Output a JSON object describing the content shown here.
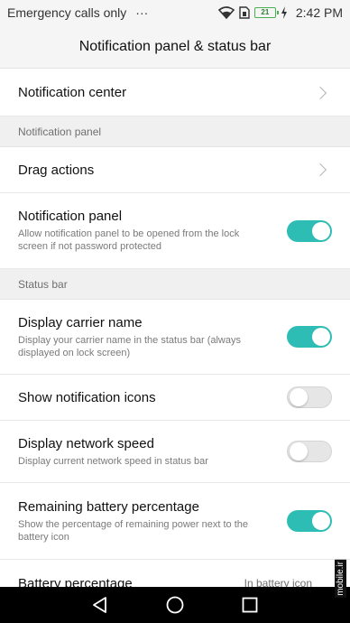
{
  "status_bar": {
    "carrier_text": "Emergency calls only",
    "more_indicator": "···",
    "battery_level": "21",
    "time": "2:42 PM",
    "icons": [
      "wifi-icon",
      "sim-icon",
      "battery-icon",
      "charging-icon"
    ]
  },
  "header": {
    "title": "Notification panel & status bar"
  },
  "items": {
    "notification_center": {
      "title": "Notification center"
    },
    "notification_panel_section": "Notification panel",
    "drag_actions": {
      "title": "Drag actions"
    },
    "notification_panel": {
      "title": "Notification panel",
      "subtitle": "Allow notification panel to be opened from the lock screen if not password protected",
      "enabled": true
    },
    "status_bar_section": "Status bar",
    "display_carrier_name": {
      "title": "Display carrier name",
      "subtitle": "Display your carrier name in the status bar (always displayed on lock screen)",
      "enabled": true
    },
    "show_notification_icons": {
      "title": "Show notification icons",
      "enabled": false
    },
    "display_network_speed": {
      "title": "Display network speed",
      "subtitle": "Display current network speed in status bar",
      "enabled": false
    },
    "remaining_battery_percentage": {
      "title": "Remaining battery percentage",
      "subtitle": "Show the percentage of remaining power next to the battery icon",
      "enabled": true
    },
    "battery_percentage": {
      "title": "Battery percentage",
      "value": "In battery icon"
    }
  },
  "nav": {
    "back": "back-icon",
    "home": "home-icon",
    "recents": "recents-icon"
  },
  "watermark": "mobile.ir",
  "colors": {
    "accent": "#2ebdb4",
    "section_bg": "#f0f0f0",
    "nav_bg": "#000000"
  }
}
